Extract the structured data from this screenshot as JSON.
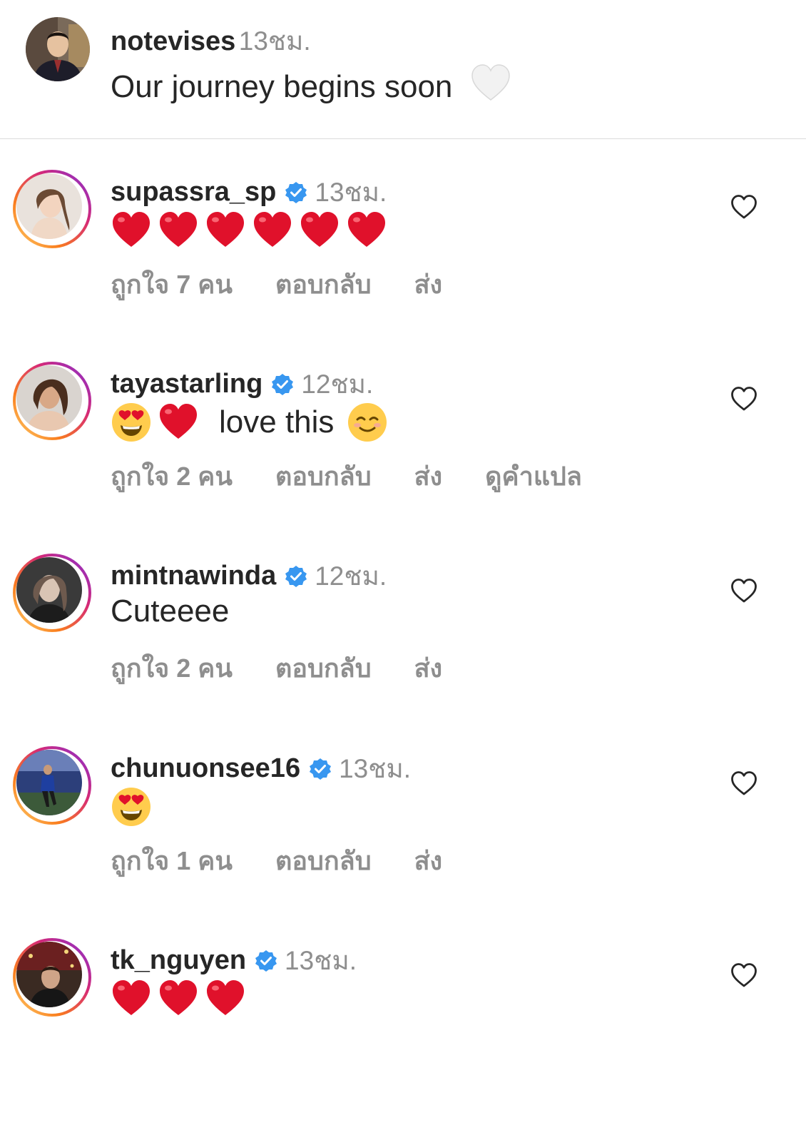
{
  "caption": {
    "username": "notevises",
    "time": "13ชม.",
    "text": "Our journey begins soon",
    "emoji_icon": "white-heart-icon"
  },
  "comments": [
    {
      "username": "supassra_sp",
      "verified": true,
      "time": "13ชม.",
      "body_emojis": [
        "red-heart",
        "red-heart",
        "red-heart",
        "red-heart",
        "red-heart",
        "red-heart"
      ],
      "likes": "ถูกใจ 7 คน",
      "reply": "ตอบกลับ",
      "send": "ส่ง"
    },
    {
      "username": "tayastarling",
      "verified": true,
      "time": "12ชม.",
      "body_prefix_emojis": [
        "heart-eyes",
        "red-heart"
      ],
      "body_text": "love this",
      "body_suffix_emojis": [
        "smiling-face"
      ],
      "likes": "ถูกใจ 2 คน",
      "reply": "ตอบกลับ",
      "send": "ส่ง",
      "translate": "ดูคำแปล"
    },
    {
      "username": "mintnawinda",
      "verified": true,
      "time": "12ชม.",
      "body_text": "Cuteeee",
      "likes": "ถูกใจ 2 คน",
      "reply": "ตอบกลับ",
      "send": "ส่ง"
    },
    {
      "username": "chunuonsee16",
      "verified": true,
      "time": "13ชม.",
      "body_emojis": [
        "heart-eyes"
      ],
      "likes": "ถูกใจ 1 คน",
      "reply": "ตอบกลับ",
      "send": "ส่ง"
    },
    {
      "username": "tk_nguyen",
      "verified": true,
      "time": "13ชม.",
      "body_emojis": [
        "red-heart",
        "red-heart",
        "red-heart"
      ]
    }
  ],
  "colors": {
    "text": "#262626",
    "secondary": "#8e8e8e",
    "verified": "#3897f0",
    "heart": "#e0112b"
  },
  "icons": {
    "like": "heart-outline-icon",
    "verified": "verified-badge-icon"
  }
}
